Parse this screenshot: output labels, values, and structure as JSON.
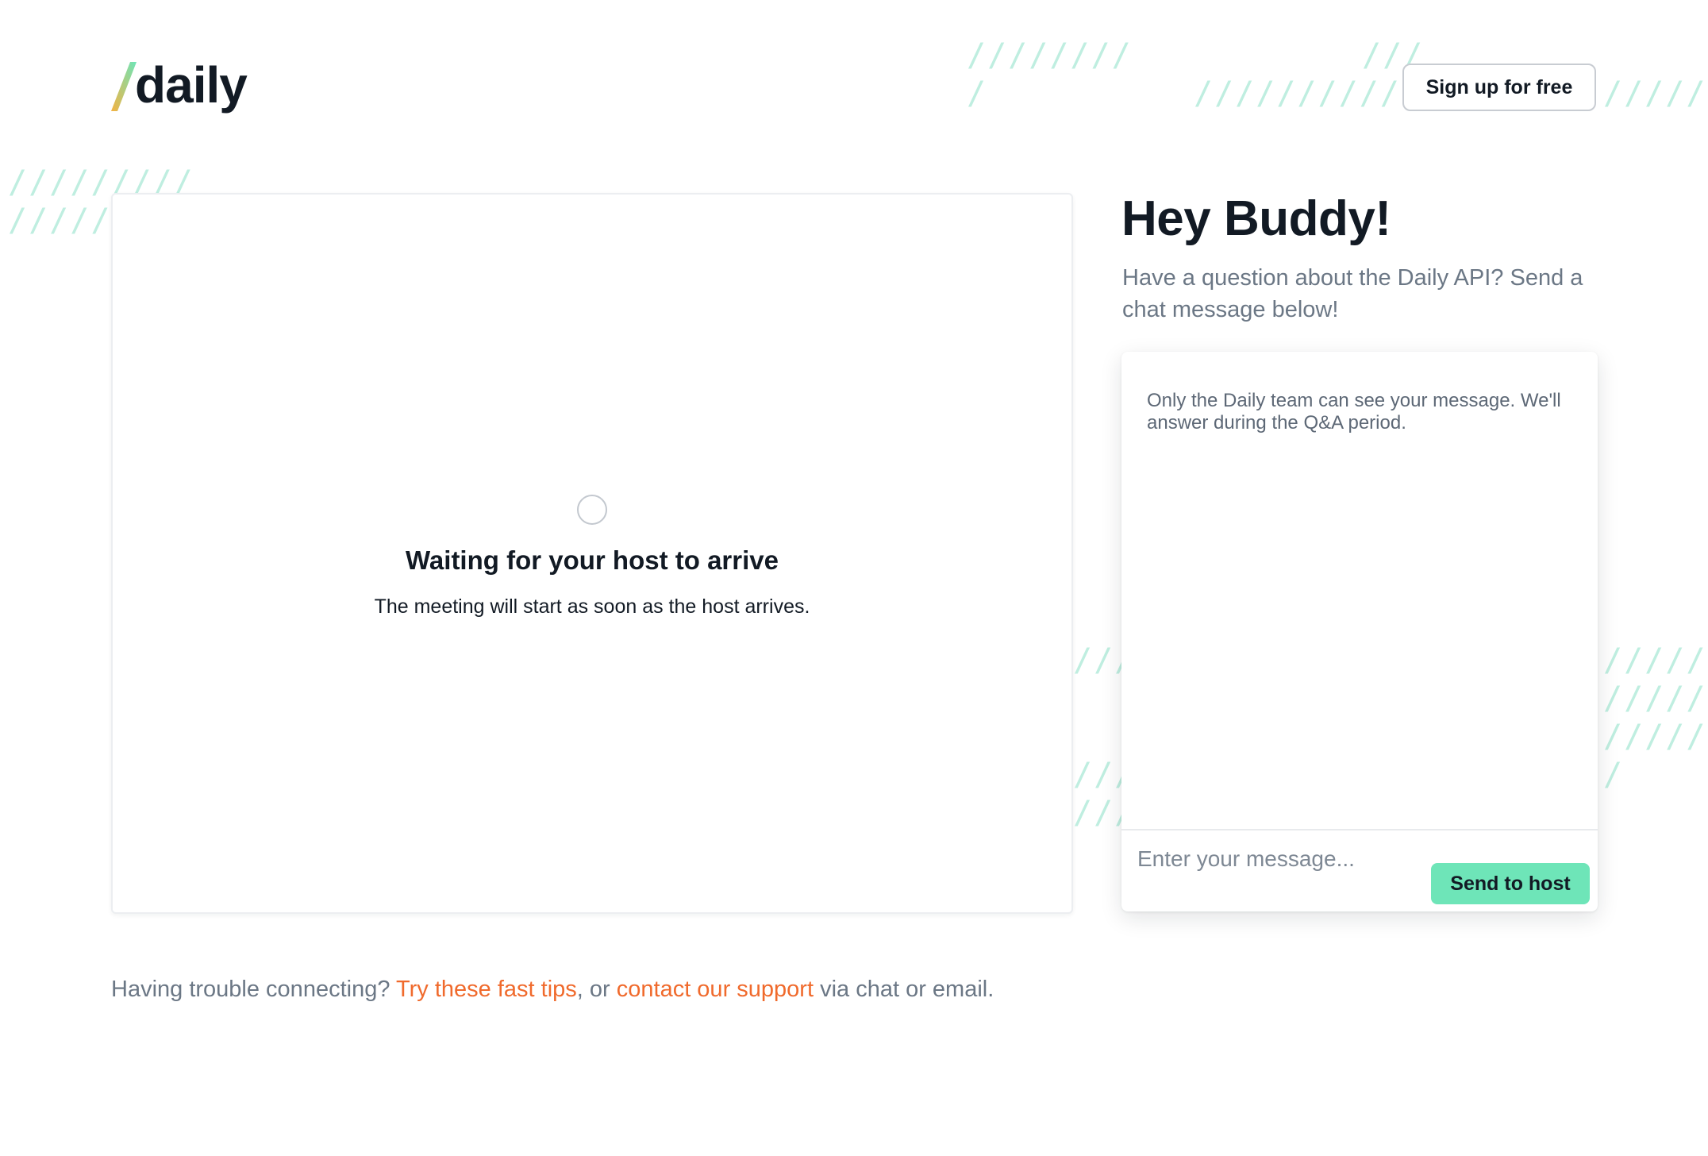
{
  "brand": {
    "name": "daily",
    "slash_colors": [
      "#6ee5b8",
      "#f3b343"
    ]
  },
  "header": {
    "signup_label": "Sign up for free"
  },
  "video": {
    "status_title": "Waiting for your host to arrive",
    "status_subtitle": "The meeting will start as soon as the host arrives."
  },
  "sidebar": {
    "greeting": "Hey Buddy!",
    "intro": "Have a question about the Daily API? Send a chat message below!"
  },
  "chat": {
    "note": "Only the Daily team can see your message. We'll answer during the Q&A period.",
    "input_placeholder": "Enter your message...",
    "input_value": "",
    "send_label": "Send to host"
  },
  "help": {
    "prefix": "Having trouble connecting? ",
    "tips_link": "Try these fast tips",
    "middle": ", or ",
    "support_link": "contact our support",
    "suffix": " via chat or email."
  },
  "colors": {
    "accent_green": "#6ee5b8",
    "link_orange": "#f06a2c",
    "muted_text": "#6b7785",
    "decoration": "#bfeee0"
  }
}
